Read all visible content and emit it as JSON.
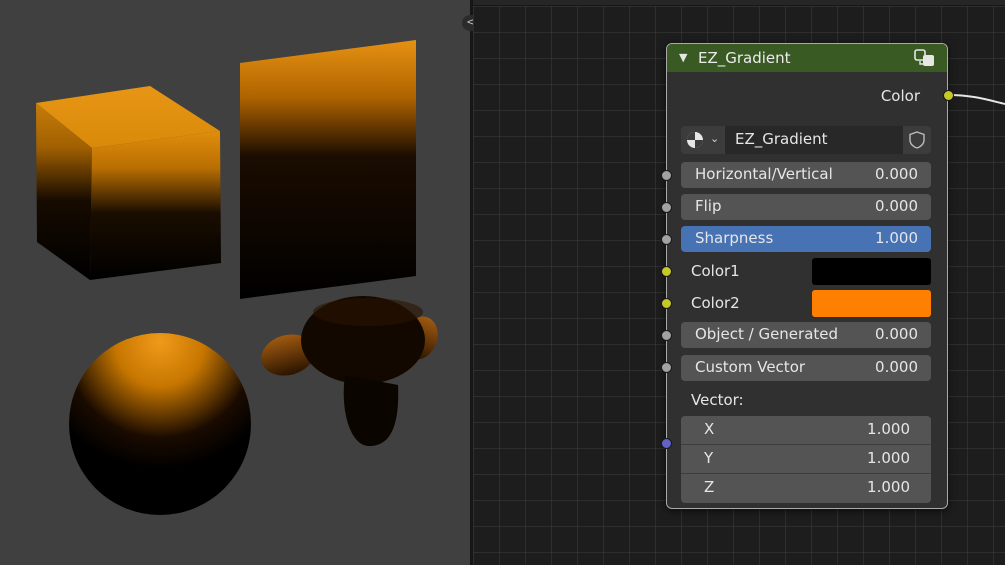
{
  "node": {
    "title": "EZ_Gradient",
    "header_color": "#3a5a24",
    "output_label": "Color",
    "datablock_name": "EZ_Gradient",
    "inputs": [
      {
        "label": "Horizontal/Vertical",
        "value": "0.000",
        "highlighted": false
      },
      {
        "label": "Flip",
        "value": "0.000",
        "highlighted": false
      },
      {
        "label": "Sharpness",
        "value": "1.000",
        "highlighted": true
      },
      {
        "label": "Color1",
        "color": "#000000"
      },
      {
        "label": "Color2",
        "color": "#ff8000"
      },
      {
        "label": "Object / Generated",
        "value": "0.000",
        "highlighted": false
      },
      {
        "label": "Custom Vector",
        "value": "0.000",
        "highlighted": false
      }
    ],
    "vector": {
      "label": "Vector:",
      "components": [
        {
          "label": "X",
          "value": "1.000"
        },
        {
          "label": "Y",
          "value": "1.000"
        },
        {
          "label": "Z",
          "value": "1.000"
        }
      ]
    },
    "icons": {
      "collapse": "triangle-down-icon",
      "node_group": "node-group-icon",
      "browse": "material-sphere-icon",
      "fake_user": "shield-icon"
    }
  },
  "viewport": {
    "gradient_dark": "#000000",
    "gradient_light": "#ff8c00",
    "objects": [
      "cube",
      "plane",
      "sphere",
      "monkey"
    ]
  },
  "colors": {
    "accent": "#4772b3",
    "socket_float": "#a1a1a1",
    "socket_color": "#c7c729",
    "socket_vector": "#6363c7"
  }
}
